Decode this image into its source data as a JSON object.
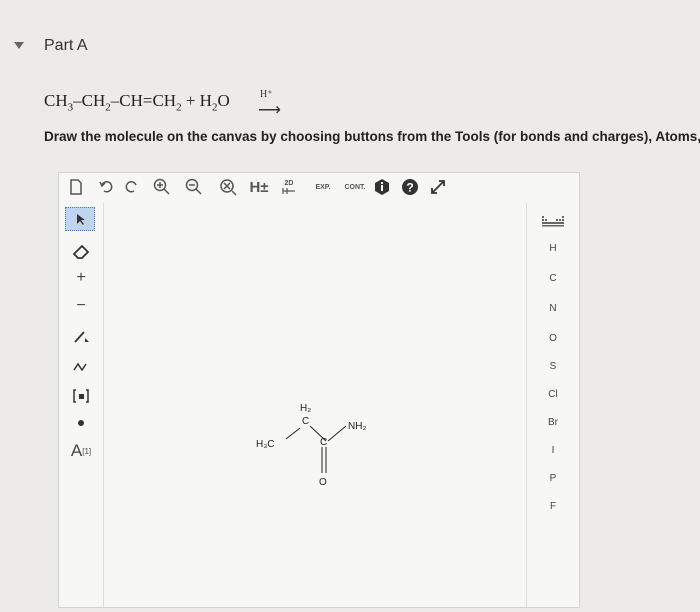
{
  "part": {
    "title": "Part A"
  },
  "reaction": {
    "r1": "CH",
    "r1_sub": "3",
    "r2": "–CH",
    "r2_sub": "2",
    "r3": "–CH=CH",
    "r3_sub": "2",
    "r4": " + H",
    "r4_sub": "2",
    "r5": "O",
    "catalyst": "H⁺",
    "arrow": "⟶"
  },
  "instructions": "Draw the molecule on the canvas by choosing buttons from the Tools (for bonds and charges), Atoms, an",
  "toolbar": {
    "h_plus": "H±",
    "label_2d": "2D",
    "label_exp": "EXP.",
    "label_cont": "CONT."
  },
  "left_tools": {
    "plus": "+",
    "minus": "−",
    "atom_map": "A",
    "atom_map_sup": "[1]"
  },
  "atoms": [
    "H",
    "C",
    "N",
    "O",
    "S",
    "Cl",
    "Br",
    "I",
    "P",
    "F"
  ],
  "molecule": {
    "h3c": "H₃C",
    "h2": "H₂",
    "c1": "C",
    "c2": "C",
    "nh2": "NH₂",
    "o": "O"
  }
}
